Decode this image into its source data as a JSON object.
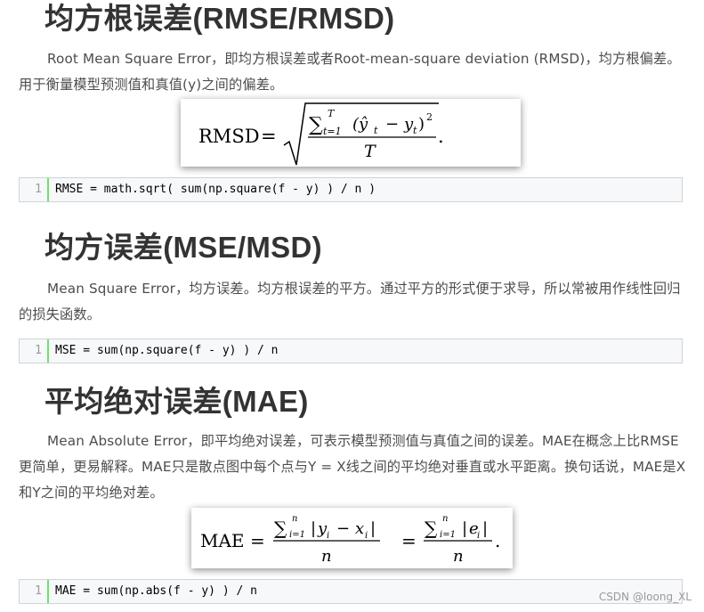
{
  "sections": [
    {
      "heading": "均方根误差(RMSE/RMSD)",
      "paragraph": "Root Mean Square Error，即均方根误差或者Root-mean-square deviation (RMSD)，均方根偏差。用于衡量模型预测值和真值(y)之间的偏差。",
      "code": {
        "line": "1",
        "text": "RMSE = math.sqrt( sum(np.square(f - y) ) / n )"
      }
    },
    {
      "heading": "均方误差(MSE/MSD)",
      "paragraph": "Mean Square Error，均方误差。均方根误差的平方。通过平方的形式便于求导，所以常被用作线性回归的损失函数。",
      "code": {
        "line": "1",
        "text": "MSE = sum(np.square(f - y) ) / n"
      }
    },
    {
      "heading": "平均绝对误差(MAE)",
      "paragraph": "Mean Absolute Error，即平均绝对误差，可表示模型预测值与真值之间的误差。MAE在概念上比RMSE更简单，更易解释。MAE只是散点图中每个点与Y = X线之间的平均绝对垂直或水平距离。换句话说，MAE是X和Y之间的平均绝对差。",
      "code": {
        "line": "1",
        "text": "MAE = sum(np.abs(f - y) ) / n"
      }
    }
  ],
  "formulas": {
    "rmsd": {
      "lhs": "RMSD",
      "eq": "=",
      "sum": "∑",
      "upper": "T",
      "lower": "t=1",
      "term_a": "(ŷ",
      "sub_a": "t",
      "minus": "−",
      "term_b": "y",
      "sub_b": "t",
      "close": ")",
      "power": "2",
      "denom": "T",
      "end": "."
    },
    "mae": {
      "lhs": "MAE",
      "eq1": "=",
      "eq2": "=",
      "sum": "∑",
      "upper": "n",
      "lower": "i=1",
      "bar": "|",
      "y": "y",
      "x": "x",
      "sub": "i",
      "minus": "−",
      "e": "e",
      "denom": "n",
      "end": "."
    }
  },
  "watermark": "CSDN @loong_XL"
}
